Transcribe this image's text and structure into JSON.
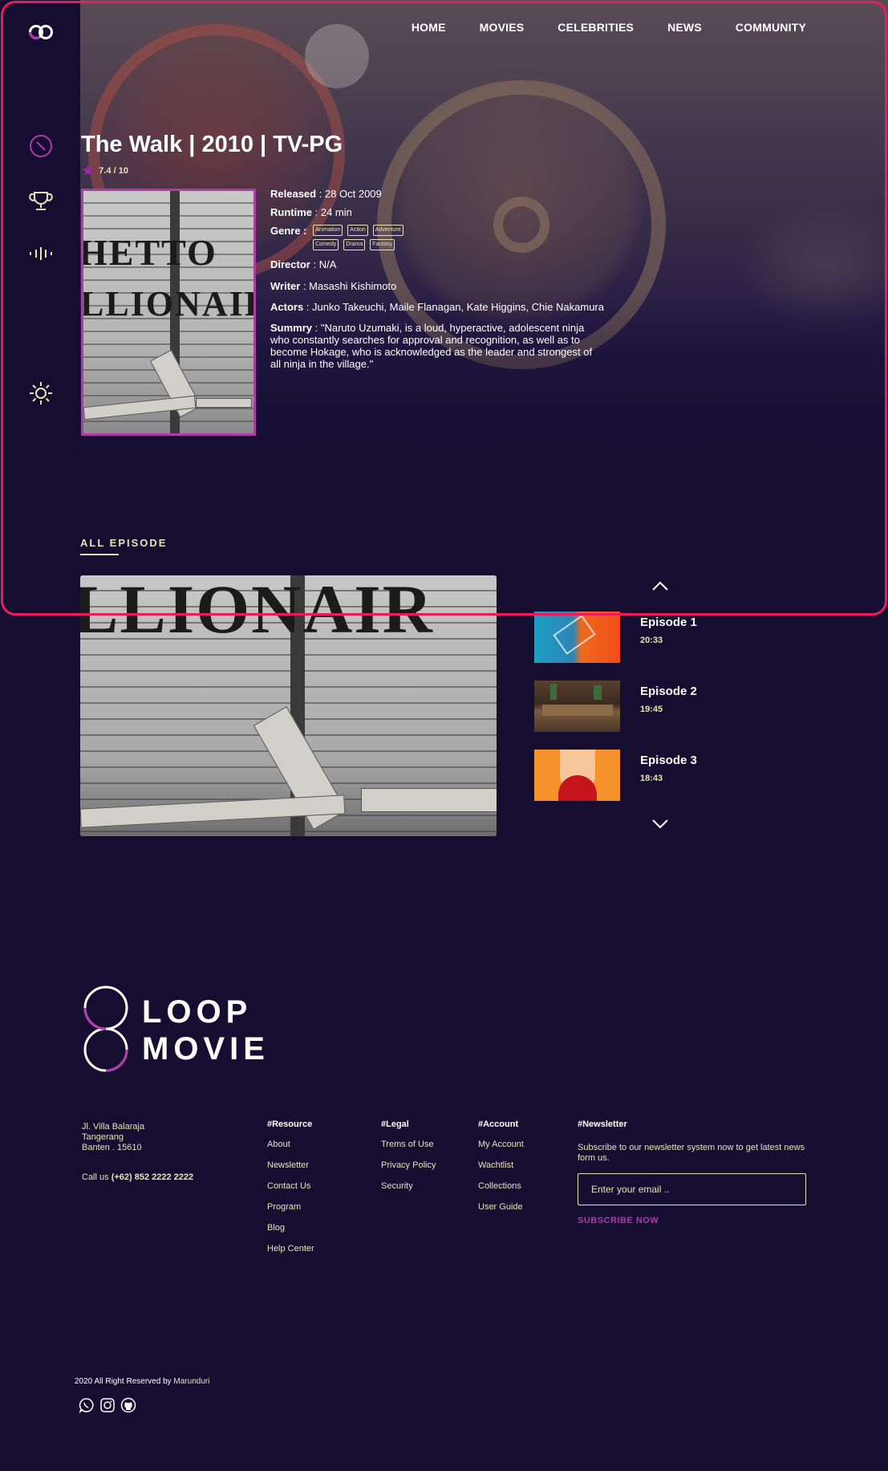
{
  "nav": {
    "items": [
      "HOME",
      "MOVIES",
      "CELEBRITIES",
      "NEWS",
      "COMMUNITY"
    ]
  },
  "sidebar": {
    "icons": [
      "compass-icon",
      "trophy-icon",
      "equalizer-icon",
      "sun-icon"
    ]
  },
  "movie": {
    "title": "The Walk | 2010 | TV-PG",
    "rating": "7.4 / 10",
    "released_label": "Released",
    "released": " : 28 Oct 2009",
    "runtime_label": "Runtime",
    "runtime": " : 24 min",
    "genre_label": "Genre :",
    "genres": [
      "Animation",
      "Action",
      "Adventure",
      "Comedy",
      "Drama",
      "Fantasy"
    ],
    "director_label": "Director",
    "director": " : N/A",
    "writer_label": "Writer",
    "writer": " : Masashi Kishimoto",
    "actors_label": "Actors",
    "actors": " : Junko Takeuchi, Maile Flanagan, Kate Higgins, Chie Nakamura",
    "summary_label": "Summry",
    "summary": " : \"Naruto Uzumaki, is a loud, hyperactive, adolescent ninja who constantly searches for approval and recognition, as well as to become Hokage, who is acknowledged as the leader and strongest of all ninja in the village.\"",
    "poster_graffiti": [
      "HETTO",
      "LLIONAIR"
    ]
  },
  "episodes": {
    "heading": "ALL EPISODE",
    "player_graffiti": "LLIONAIR",
    "items": [
      {
        "name": "Episode 1",
        "duration": "20:33"
      },
      {
        "name": "Episode 2",
        "duration": "19:45"
      },
      {
        "name": "Episode 3",
        "duration": "18:43"
      }
    ]
  },
  "footer": {
    "brand_line1": "LOOP",
    "brand_line2": "MOVIE",
    "address": [
      "Jl. Villa Balaraja",
      "Tangerang",
      "Banten . 15610"
    ],
    "call_label": "Call us ",
    "phone": "(+62) 852 2222 2222",
    "columns": [
      {
        "title": "#Resource",
        "links": [
          "About",
          "Newsletter",
          "Contact Us",
          "Program",
          "Blog",
          "Help Center"
        ]
      },
      {
        "title": "#Legal",
        "links": [
          "Trems of Use",
          "Privacy Policy",
          "Security"
        ]
      },
      {
        "title": "#Account",
        "links": [
          "My Account",
          "Wachtlist",
          "Collections",
          "User Guide"
        ]
      }
    ],
    "newsletter_title": "#Newsletter",
    "newsletter_text": "Subscribe to our newsletter system now to get latest news form us.",
    "email_placeholder": "Enter your email ..",
    "subscribe_label": "SUBSCRIBE NOW",
    "copyright": "2020 All Right Reserved by ",
    "author": "Marunduri",
    "social": [
      "whatsapp-icon",
      "instagram-icon",
      "github-icon"
    ]
  },
  "colors": {
    "background": "#150e30",
    "accent": "#b03aa9",
    "frame": "#ec1b5e",
    "cream": "#e9e2b8"
  }
}
